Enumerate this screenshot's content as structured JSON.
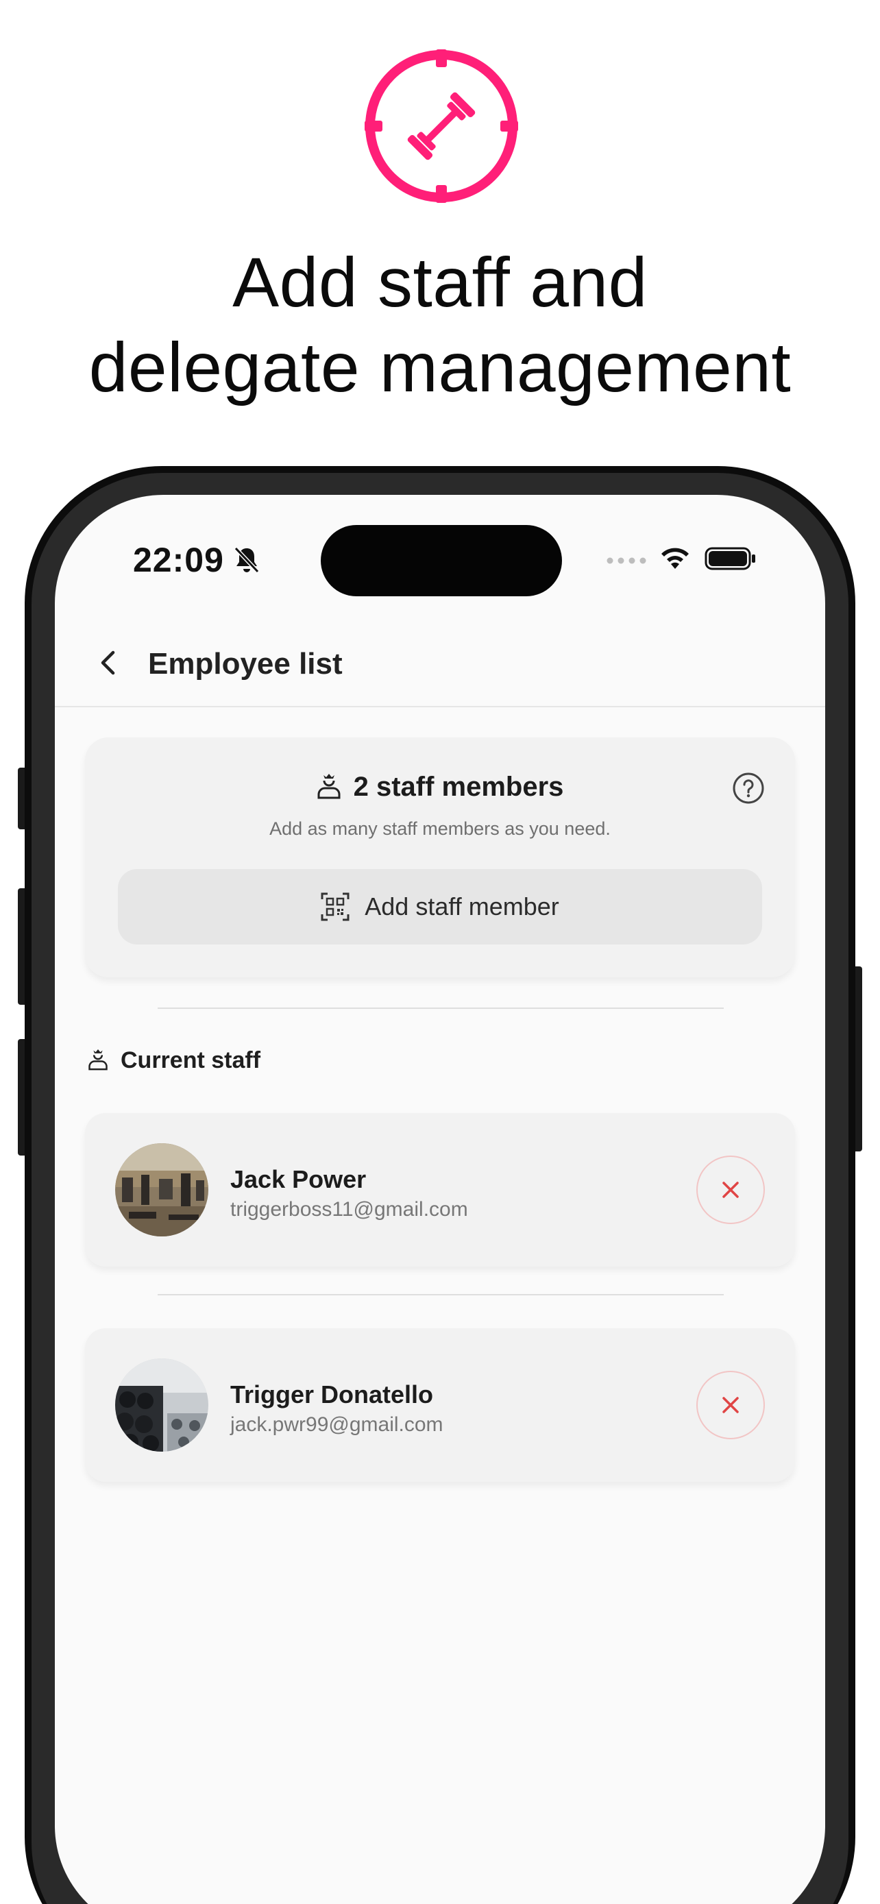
{
  "promo": {
    "headline_line1": "Add staff and",
    "headline_line2": "delegate management",
    "accent_color": "#ff1f78",
    "logo_icon": "dumbbell-in-crosshair-icon"
  },
  "status_bar": {
    "time": "22:09",
    "icons": [
      "bell-slash-icon",
      "signal-dots-icon",
      "wifi-icon",
      "battery-icon"
    ]
  },
  "app_bar": {
    "back_icon": "chevron-left-icon",
    "title": "Employee list"
  },
  "summary": {
    "staff_count_label": "2 staff members",
    "subtitle": "Add as many staff members as you need.",
    "add_button_label": "Add staff member",
    "add_button_icon": "qr-code-icon",
    "help_icon": "question-circle-icon"
  },
  "section": {
    "title": "Current staff",
    "icon": "staff-person-icon"
  },
  "employees": [
    {
      "name": "Jack Power",
      "email": "triggerboss11@gmail.com",
      "avatar": "gym-interior-photo"
    },
    {
      "name": "Trigger Donatello",
      "email": "jack.pwr99@gmail.com",
      "avatar": "dumbbell-rack-photo"
    }
  ],
  "colors": {
    "accent": "#ff1f78",
    "remove_icon": "#e04545",
    "card_bg": "#f2f2f2",
    "screen_bg": "#fafafa"
  }
}
